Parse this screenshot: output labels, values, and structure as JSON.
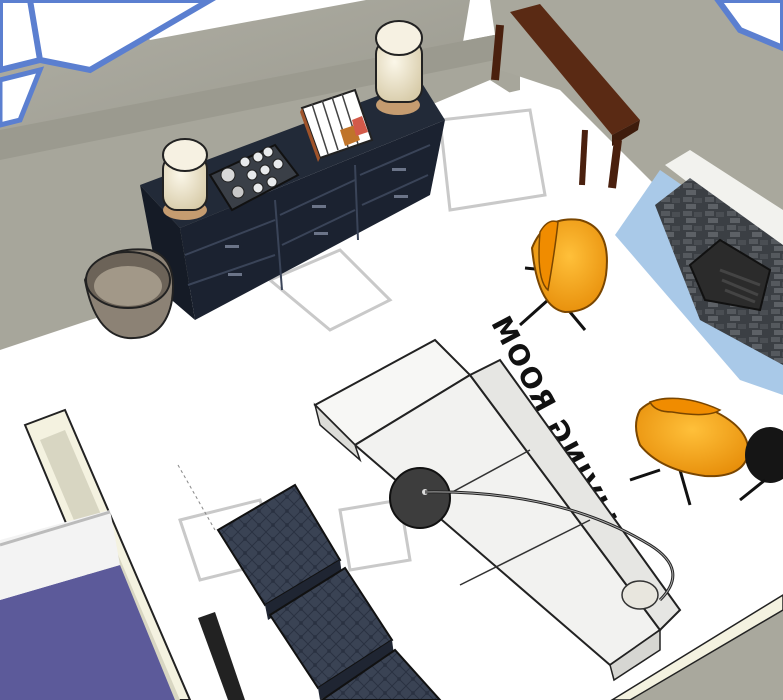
{
  "scene": {
    "floor_label": "LIVING ROOM"
  },
  "colors": {
    "floor": "#ffffff",
    "wall": "#a8a79c",
    "wall_dark": "#8f8e84",
    "window_frame": "#5b7fd0",
    "dresser": "#1f2633",
    "console_table": "#5a2a14",
    "chair": "#f59a10",
    "sofa": "#f4f4f2",
    "ottoman": "#323a4a",
    "rug_accent": "#5c5a9a",
    "fireplace_tile": "#a9c9e8"
  },
  "icons": [
    "lamp-icon",
    "books-icon",
    "tray-icon",
    "basket-icon",
    "chair-icon",
    "sofa-icon",
    "floor-lamp-icon",
    "ottoman-icon",
    "fireplace-icon"
  ]
}
